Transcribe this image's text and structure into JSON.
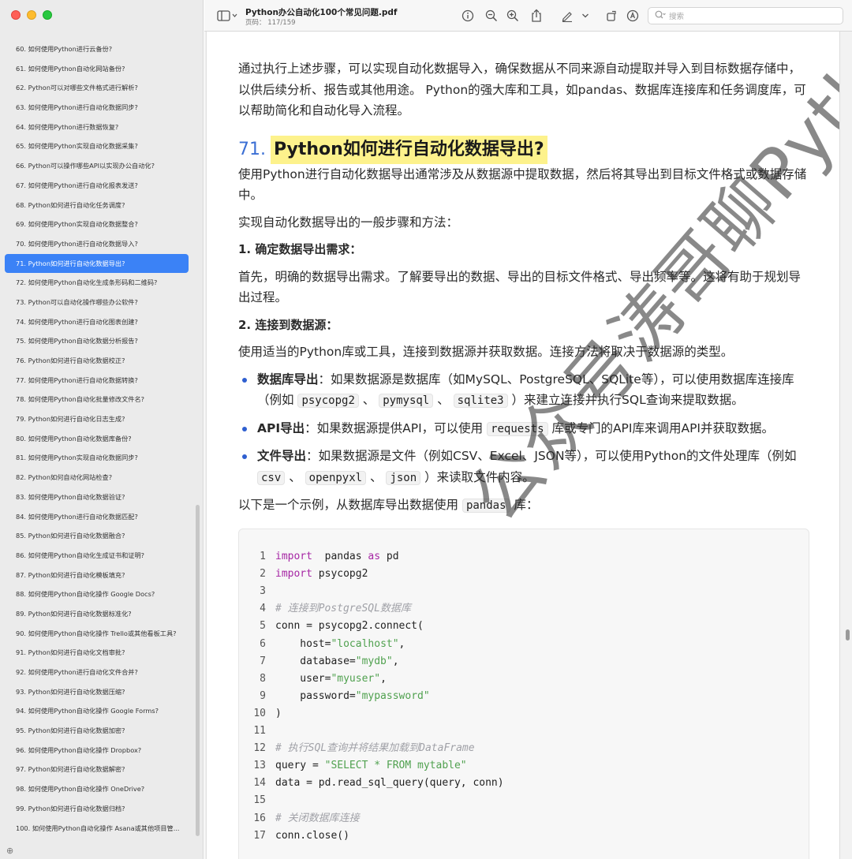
{
  "window": {
    "doc_title": "Python办公自动化100个常见问题.pdf",
    "page_indicator": "页码： 117/159",
    "search_placeholder": "搜索"
  },
  "sidebar": {
    "items": [
      "60. 如何使用Python进行云备份?",
      "61. 如何使用Python自动化网站备份?",
      "62. Python可以对哪些文件格式进行解析?",
      "63. 如何使用Python进行自动化数据同步?",
      "64. 如何使用Python进行数据恢复?",
      "65. 如何使用Python实现自动化数据采集?",
      "66. Python可以操作哪些API以实现办公自动化?",
      "67. 如何使用Python进行自动化报表发送?",
      "68. Python如何进行自动化任务调度?",
      "69. 如何使用Python实现自动化数据整合?",
      "70. 如何使用Python进行自动化数据导入?",
      "71. Python如何进行自动化数据导出?",
      "72. 如何使用Python自动化生成条形码和二维码?",
      "73. Python可以自动化操作哪些办公软件?",
      "74. 如何使用Python进行自动化图表创建?",
      "75. 如何使用Python自动化数据分析报告?",
      "76. Python如何进行自动化数据校正?",
      "77. 如何使用Python进行自动化数据转换?",
      "78. 如何使用Python自动化批量修改文件名?",
      "79. Python如何进行自动化日志生成?",
      "80. 如何使用Python自动化数据库备份?",
      "81. 如何使用Python实现自动化数据同步?",
      "82. Python如何自动化网站检查?",
      "83. 如何使用Python自动化数据验证?",
      "84. 如何使用Python进行自动化数据匹配?",
      "85. Python如何进行自动化数据融合?",
      "86. 如何使用Python自动化生成证书和证明?",
      "87. Python如何进行自动化模板填充?",
      "88. 如何使用Python自动化操作 Google Docs?",
      "89. Python如何进行自动化数据标准化?",
      "90. 如何使用Python自动化操作 Trello或其他看板工具?",
      "91. Python如何进行自动化文档审批?",
      "92. 如何使用Python进行自动化文件合并?",
      "93. Python如何进行自动化数据压缩?",
      "94. 如何使用Python自动化操作 Google Forms?",
      "95. Python如何进行自动化数据加密?",
      "96. 如何使用Python自动化操作 Dropbox?",
      "97. Python如何进行自动化数据解密?",
      "98. 如何使用Python自动化操作 OneDrive?",
      "99. Python如何进行自动化数据归档?",
      "100. 如何使用Python自动化操作 Asana或其他项目管..."
    ],
    "active_index": 11,
    "footer_icon": "add-icon"
  },
  "content": {
    "intro": "通过执行上述步骤，可以实现自动化数据导入，确保数据从不同来源自动提取并导入到目标数据存储中，以供后续分析、报告或其他用途。 Python的强大库和工具，如pandas、数据库连接库和任务调度库，可以帮助简化和自动化导入流程。",
    "section_num": "71.",
    "section_title": "Python如何进行自动化数据导出?",
    "p1": "使用Python进行自动化数据导出通常涉及从数据源中提取数据，然后将其导出到目标文件格式或数据存储中。",
    "p2": "实现自动化数据导出的一般步骤和方法：",
    "h_step1": "1. 确定数据导出需求：",
    "p_step1": "首先，明确的数据导出需求。了解要导出的数据、导出的目标文件格式、导出频率等。这将有助于规划导出过程。",
    "h_step2": "2. 连接到数据源：",
    "p_step2": "使用适当的Python库或工具，连接到数据源并获取数据。连接方法将取决于数据源的类型。",
    "b1_label": "数据库导出",
    "b1_text_a": "：如果数据源是数据库（如MySQL、PostgreSQL、SQLite等），可以使用数据库连接库（例如 ",
    "b1_code1": "psycopg2",
    "b1_sep1": " 、 ",
    "b1_code2": "pymysql",
    "b1_sep2": " 、 ",
    "b1_code3": "sqlite3",
    "b1_text_b": " ）来建立连接并执行SQL查询来提取数据。",
    "b2_label": "API导出",
    "b2_text_a": "：如果数据源提供API，可以使用 ",
    "b2_code": "requests",
    "b2_text_b": " 库或专门的API库来调用API并获取数据。",
    "b3_label": "文件导出",
    "b3_text_a": "：如果数据源是文件（例如CSV、Excel、JSON等），可以使用Python的文件处理库（例如 ",
    "b3_code1": "csv",
    "b3_sep1": " 、 ",
    "b3_code2": "openpyxl",
    "b3_sep2": " 、 ",
    "b3_code3": "json",
    "b3_text_b": " ）来读取文件内容。",
    "p_example_a": "以下是一个示例，从数据库导出数据使用 ",
    "p_example_code": "pandas",
    "p_example_b": " 库："
  },
  "code": [
    {
      "n": "1",
      "parts": [
        [
          "kw",
          "import"
        ],
        [
          "",
          "  pandas "
        ],
        [
          "kw",
          "as"
        ],
        [
          "",
          " pd"
        ]
      ]
    },
    {
      "n": "2",
      "parts": [
        [
          "kw",
          "import"
        ],
        [
          "",
          " psycopg2"
        ]
      ]
    },
    {
      "n": "3",
      "parts": []
    },
    {
      "n": "4",
      "parts": [
        [
          "cm",
          "# 连接到PostgreSQL数据库"
        ]
      ]
    },
    {
      "n": "5",
      "parts": [
        [
          "",
          "conn = psycopg2.connect("
        ]
      ]
    },
    {
      "n": "6",
      "parts": [
        [
          "",
          "    host="
        ],
        [
          "str",
          "\"localhost\""
        ],
        [
          "",
          ","
        ]
      ]
    },
    {
      "n": "7",
      "parts": [
        [
          "",
          "    database="
        ],
        [
          "str",
          "\"mydb\""
        ],
        [
          "",
          ","
        ]
      ]
    },
    {
      "n": "8",
      "parts": [
        [
          "",
          "    user="
        ],
        [
          "str",
          "\"myuser\""
        ],
        [
          "",
          ","
        ]
      ]
    },
    {
      "n": "9",
      "parts": [
        [
          "",
          "    password="
        ],
        [
          "str",
          "\"mypassword\""
        ]
      ]
    },
    {
      "n": "10",
      "parts": [
        [
          "",
          ")"
        ]
      ]
    },
    {
      "n": "11",
      "parts": []
    },
    {
      "n": "12",
      "parts": [
        [
          "cm",
          "# 执行SQL查询并将结果加载到DataFrame"
        ]
      ]
    },
    {
      "n": "13",
      "parts": [
        [
          "",
          "query = "
        ],
        [
          "str",
          "\"SELECT * FROM mytable\""
        ]
      ]
    },
    {
      "n": "14",
      "parts": [
        [
          "",
          "data = pd.read_sql_query(query, conn)"
        ]
      ]
    },
    {
      "n": "15",
      "parts": []
    },
    {
      "n": "16",
      "parts": [
        [
          "cm",
          "# 关闭数据库连接"
        ]
      ]
    },
    {
      "n": "17",
      "parts": [
        [
          "",
          "conn.close()"
        ]
      ]
    }
  ],
  "watermark": "公众号涛哥聊Python"
}
